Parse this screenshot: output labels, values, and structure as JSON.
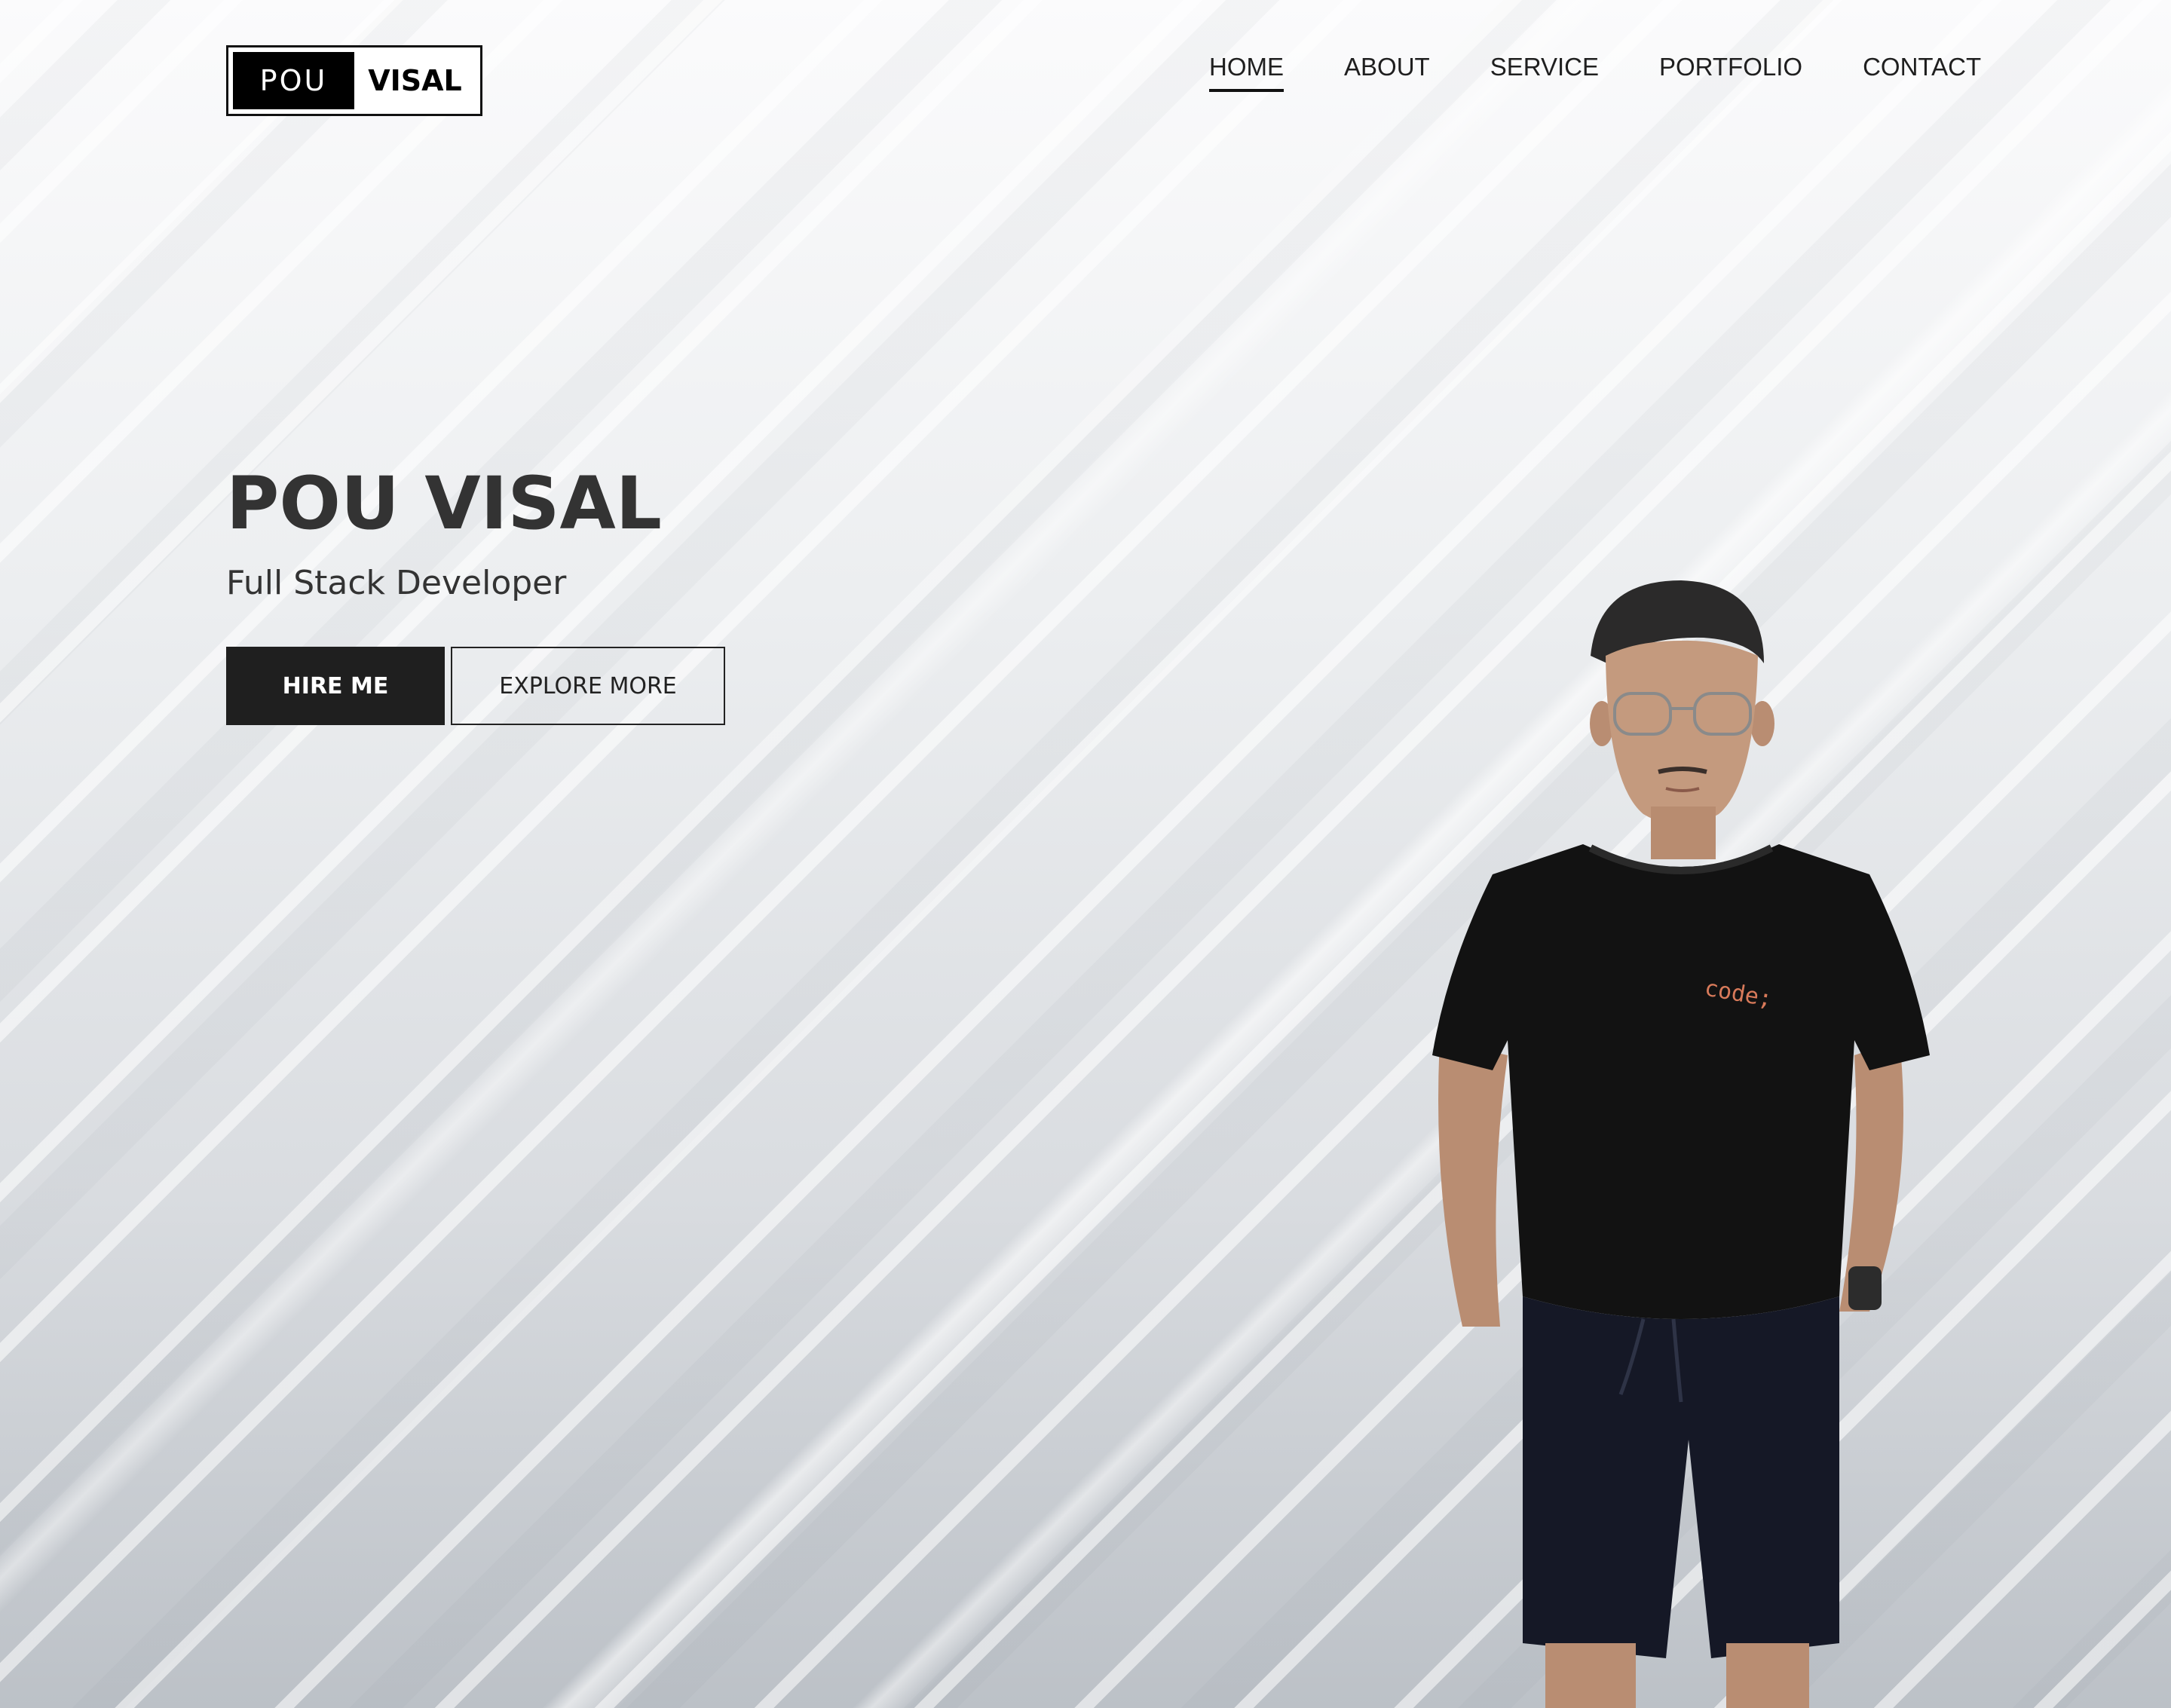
{
  "logo": {
    "left_text": "POU",
    "right_text": "VISAL"
  },
  "nav": {
    "items": [
      {
        "label": "HOME",
        "active": true
      },
      {
        "label": "ABOUT",
        "active": false
      },
      {
        "label": "SERVICE",
        "active": false
      },
      {
        "label": "PORTFOLIO",
        "active": false
      },
      {
        "label": "CONTACT",
        "active": false
      }
    ]
  },
  "hero": {
    "title": "POU VISAL",
    "subtitle": "Full Stack Developer",
    "hire_label": "HIRE ME",
    "explore_label": "EXPLORE MORE"
  },
  "portrait": {
    "shirt_text": "code;"
  },
  "colors": {
    "primary_dark": "#1f1f1f",
    "text": "#333333",
    "background_top": "#fbfbfc",
    "background_bottom": "#bcc1c7"
  }
}
